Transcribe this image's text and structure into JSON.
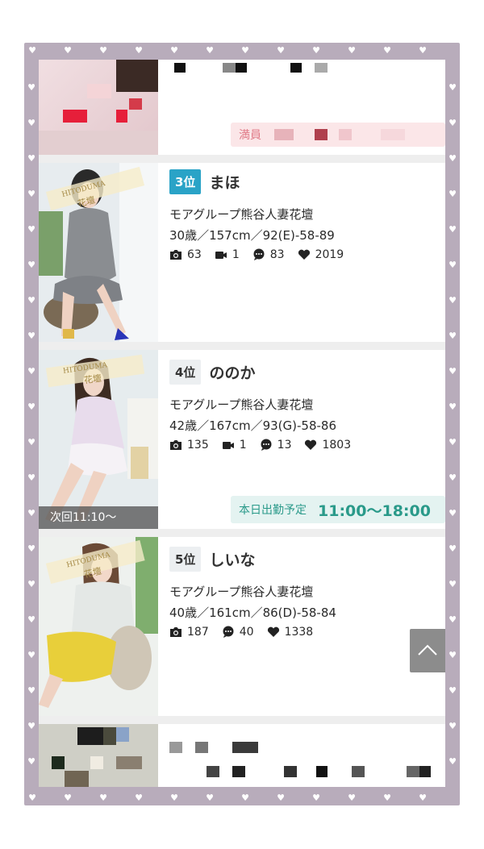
{
  "ranking": [
    {
      "rank_label": "3位",
      "name": "まほ",
      "shop": "モアグループ熊谷人妻花壇",
      "spec": "30歳／157cm／92(E)-58-89",
      "photos": "63",
      "videos": "1",
      "comments": "83",
      "likes": "2019"
    },
    {
      "rank_label": "4位",
      "name": "ののか",
      "shop": "モアグループ熊谷人妻花壇",
      "spec": "42歳／167cm／93(G)-58-86",
      "photos": "135",
      "videos": "1",
      "comments": "13",
      "likes": "1803",
      "next_label": "次回11:10〜",
      "schedule_label": "本日出勤予定",
      "schedule_time": "11:00〜18:00"
    },
    {
      "rank_label": "5位",
      "name": "しいな",
      "shop": "モアグループ熊谷人妻花壇",
      "spec": "40歳／161cm／86(D)-58-84",
      "photos": "187",
      "comments": "40",
      "likes": "1338"
    }
  ],
  "top_card": {
    "status_prefix": "満員"
  },
  "photo_watermark": {
    "line1": "HITODUMA",
    "line2": "花壇"
  },
  "icons": [
    "camera-icon",
    "video-icon",
    "comment-icon",
    "heart-icon",
    "chevron-up-icon"
  ],
  "colors": {
    "frame": "#b8acbb",
    "rank_top": "#2aa3c7",
    "schedule": "#2a9a8a"
  }
}
